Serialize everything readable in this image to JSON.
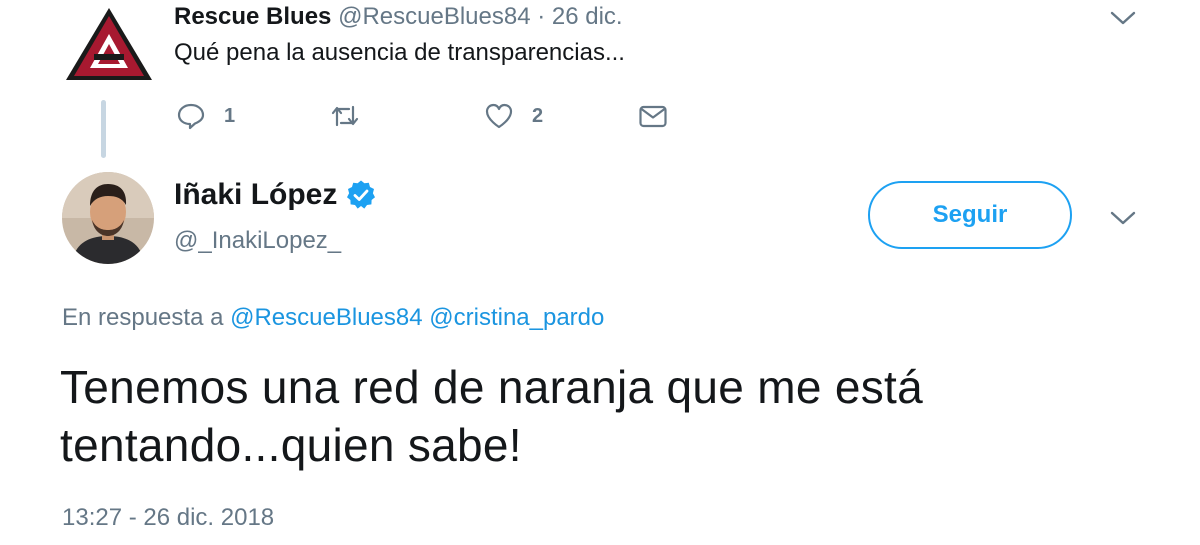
{
  "parent_tweet": {
    "display_name": "Rescue Blues",
    "handle": "@RescueBlues84",
    "separator": " · ",
    "time": "26 dic.",
    "text": "Qué pena la ausencia de transparencias...",
    "avatar_icon": "diamondbacks-a-logo-icon",
    "actions": {
      "reply_count": "1",
      "retweet_count": "",
      "like_count": "2"
    }
  },
  "main_tweet": {
    "display_name": "Iñaki López",
    "handle": "@_InakiLopez_",
    "verified_icon": "verified-badge-icon",
    "follow_label": "Seguir",
    "reply_prefix": "En respuesta a ",
    "reply_mentions": [
      "@RescueBlues84",
      "@cristina_pardo"
    ],
    "text_line1": "Tenemos una red de naranja que me está",
    "text_line2": "tentando...quien sabe!",
    "timestamp": "13:27 - 26 dic. 2018"
  },
  "colors": {
    "accent": "#1da1f2",
    "link": "#1b95e0",
    "secondary_text": "#657786",
    "primary_text": "#14171a",
    "thread_line": "#c7d6e2",
    "logo_red": "#a71930",
    "logo_black": "#1a1a1a"
  }
}
